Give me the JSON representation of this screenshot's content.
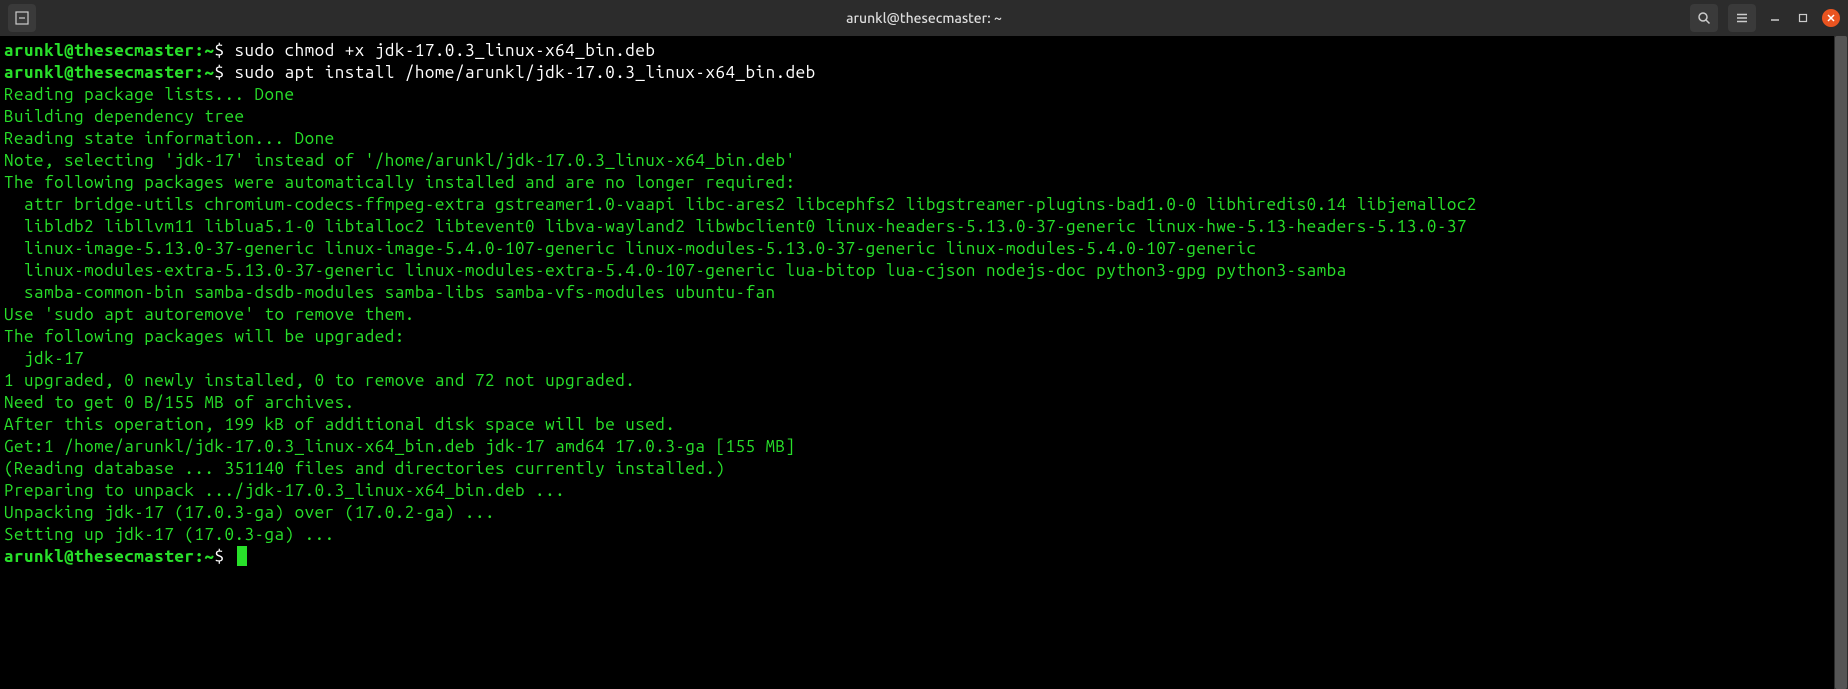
{
  "titlebar": {
    "title": "arunkl@thesecmaster: ~"
  },
  "prompt": {
    "user_host": "arunkl@thesecmaster",
    "separator": ":",
    "path": "~",
    "dollar": "$"
  },
  "commands": [
    "sudo chmod +x jdk-17.0.3_linux-x64_bin.deb",
    "sudo apt install /home/arunkl/jdk-17.0.3_linux-x64_bin.deb"
  ],
  "output": [
    "Reading package lists... Done",
    "Building dependency tree",
    "Reading state information... Done",
    "Note, selecting 'jdk-17' instead of '/home/arunkl/jdk-17.0.3_linux-x64_bin.deb'",
    "The following packages were automatically installed and are no longer required:",
    "  attr bridge-utils chromium-codecs-ffmpeg-extra gstreamer1.0-vaapi libc-ares2 libcephfs2 libgstreamer-plugins-bad1.0-0 libhiredis0.14 libjemalloc2",
    "  libldb2 libllvm11 liblua5.1-0 libtalloc2 libtevent0 libva-wayland2 libwbclient0 linux-headers-5.13.0-37-generic linux-hwe-5.13-headers-5.13.0-37",
    "  linux-image-5.13.0-37-generic linux-image-5.4.0-107-generic linux-modules-5.13.0-37-generic linux-modules-5.4.0-107-generic",
    "  linux-modules-extra-5.13.0-37-generic linux-modules-extra-5.4.0-107-generic lua-bitop lua-cjson nodejs-doc python3-gpg python3-samba",
    "  samba-common-bin samba-dsdb-modules samba-libs samba-vfs-modules ubuntu-fan",
    "Use 'sudo apt autoremove' to remove them.",
    "The following packages will be upgraded:",
    "  jdk-17",
    "1 upgraded, 0 newly installed, 0 to remove and 72 not upgraded.",
    "Need to get 0 B/155 MB of archives.",
    "After this operation, 199 kB of additional disk space will be used.",
    "Get:1 /home/arunkl/jdk-17.0.3_linux-x64_bin.deb jdk-17 amd64 17.0.3-ga [155 MB]",
    "(Reading database ... 351140 files and directories currently installed.)",
    "Preparing to unpack .../jdk-17.0.3_linux-x64_bin.deb ...",
    "Unpacking jdk-17 (17.0.3-ga) over (17.0.2-ga) ...",
    "Setting up jdk-17 (17.0.3-ga) ..."
  ]
}
